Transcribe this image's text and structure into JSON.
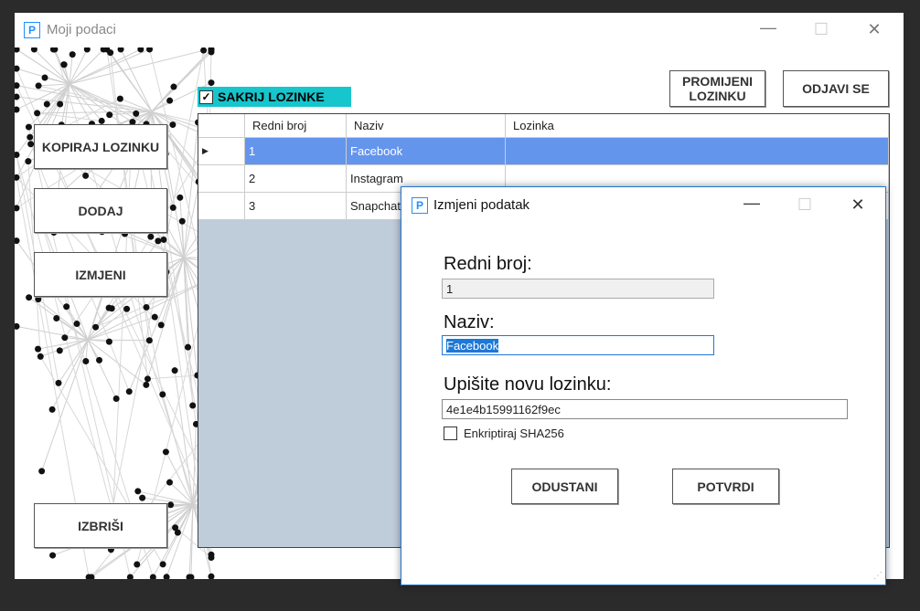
{
  "window": {
    "icon_letter": "P",
    "title": "Moji podaci",
    "minimize": "—",
    "maximize": "☐",
    "close": "✕"
  },
  "buttons": {
    "change_password": "PROMIJENI LOZINKU",
    "logout": "ODJAVI SE",
    "copy_password": "KOPIRAJ LOZINKU",
    "add": "DODAJ",
    "edit": "IZMJENI",
    "delete": "IZBRIŠI"
  },
  "hide_passwords": {
    "label": "SAKRIJ LOZINKE",
    "checked": true,
    "check_glyph": "✓"
  },
  "grid": {
    "columns": [
      "Redni broj",
      "Naziv",
      "Lozinka"
    ],
    "current_row_glyph": "▶",
    "rows": [
      {
        "redni_broj": "1",
        "naziv": "Facebook",
        "lozinka": ""
      },
      {
        "redni_broj": "2",
        "naziv": "Instagram",
        "lozinka": ""
      },
      {
        "redni_broj": "3",
        "naziv": "Snapchat",
        "lozinka": ""
      }
    ],
    "selected_color": "#6495ed",
    "background_color": "#bfccd9"
  },
  "dialog": {
    "icon_letter": "P",
    "title": "Izmjeni podatak",
    "minimize": "—",
    "maximize": "☐",
    "close": "✕",
    "redni_broj_label": "Redni broj:",
    "redni_broj_value": "1",
    "naziv_label": "Naziv:",
    "naziv_value": "Facebook",
    "nova_lozinka_label": "Upišite novu lozinku:",
    "nova_lozinka_value": "4e1e4b15991162f9ec",
    "encrypt_label": "Enkriptiraj SHA256",
    "encrypt_checked": false,
    "cancel": "ODUSTANI",
    "confirm": "POTVRDI",
    "size_grip": "⋰"
  },
  "colors": {
    "accent_cyan": "#17c5cc",
    "dialog_border": "#1e78d7"
  }
}
